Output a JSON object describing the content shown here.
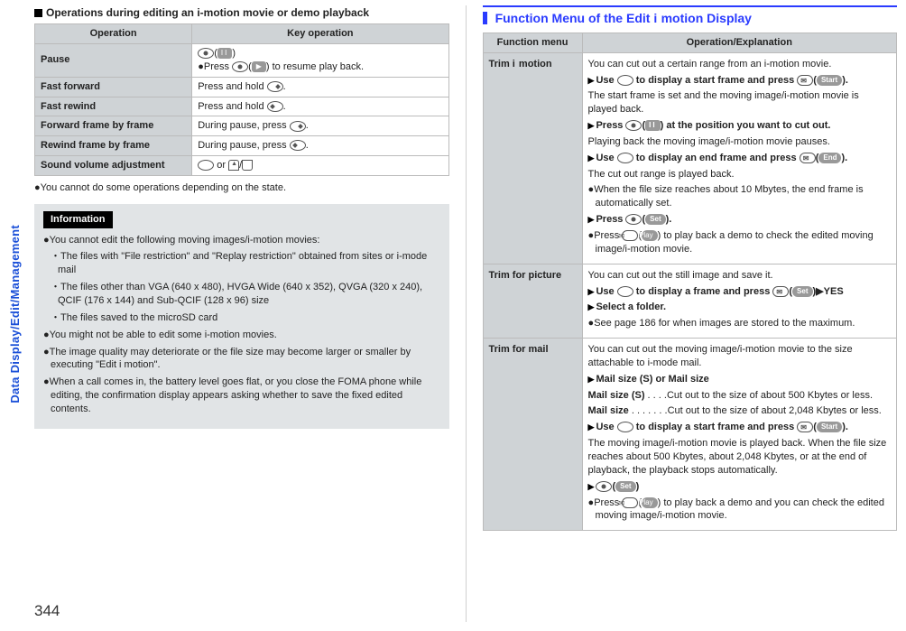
{
  "side_tab": "Data Display/Edit/Management",
  "page_number": "344",
  "left": {
    "heading": "Operations during editing an i-motion movie or demo playback",
    "table": {
      "col_operation": "Operation",
      "col_key": "Key operation",
      "rows": {
        "pause": {
          "op": "Pause",
          "key_l1a": "(",
          "key_l1b": ")",
          "key_l2": "Press ",
          "key_l2b": "(",
          "key_l2c": ") to resume play back."
        },
        "ff": {
          "op": "Fast forward",
          "key": "Press and hold ",
          "key2": "."
        },
        "fr": {
          "op": "Fast rewind",
          "key": "Press and hold ",
          "key2": "."
        },
        "ffr": {
          "op": "Forward frame by frame",
          "key": "During pause, press ",
          "key2": "."
        },
        "rfr": {
          "op": "Rewind frame by frame",
          "key": "During pause, press ",
          "key2": "."
        },
        "vol": {
          "op": "Sound volume adjustment",
          "or": " or ",
          "slash": "/"
        }
      }
    },
    "note_below": "You cannot do some operations depending on the state.",
    "info": {
      "title": "Information",
      "p1": "You cannot edit the following moving images/i-motion movies:",
      "p1a": "The files with \"File restriction\" and \"Replay restriction\" obtained from sites or i-mode mail",
      "p1b": "The files other than VGA (640 x 480), HVGA Wide (640 x 352), QVGA (320 x 240), QCIF (176 x 144) and Sub-QCIF (128 x 96) size",
      "p1c": "The files saved to the microSD card",
      "p2": "You might not be able to edit some i-motion movies.",
      "p3": "The image quality may deteriorate or the file size may become larger or smaller by executing \"Edit  i motion\".",
      "p4": "When a call comes in, the battery level goes flat, or you close the FOMA phone while editing, the confirmation display appears asking whether to save the fixed edited contents."
    }
  },
  "right": {
    "header_a": "Function Menu of the Edit ",
    "header_b": " motion Display",
    "table": {
      "col_menu": "Function menu",
      "col_op": "Operation/Explanation",
      "trim": {
        "menu_a": "Trim ",
        "menu_b": "motion",
        "p1": "You can cut out a certain range from an i-motion movie.",
        "s1a": "Use ",
        "s1b": " to display a start frame and press ",
        "s1c": "(",
        "s1d": ").",
        "p2": "The start frame is set and the moving image/i-motion movie is played back.",
        "s2a": "Press ",
        "s2b": "(",
        "s2c": ") at the position you want to cut out.",
        "p3": "Playing back the moving image/i-motion movie pauses.",
        "s3a": "Use ",
        "s3b": " to display an end frame and press ",
        "s3c": "(",
        "s3d": ").",
        "p4": "The cut out range is played back.",
        "b1": "When the file size reaches about 10 Mbytes, the end frame is automatically set.",
        "s4a": "Press ",
        "s4b": "(",
        "s4c": ").",
        "b2a": "Press ",
        "b2b": "(",
        "b2c": ") to play back a demo to check the edited moving image/i-motion movie.",
        "lbl_start": "Start",
        "lbl_end": "End",
        "lbl_set": "Set",
        "lbl_play": "Play"
      },
      "trim_pic": {
        "menu": "Trim for picture",
        "p1": "You can cut out the still image and save it.",
        "s1a": "Use ",
        "s1b": " to display a frame and press ",
        "s1c": "(",
        "s1d": ")",
        "s1e": "YES",
        "s2": "Select a folder.",
        "b1": "See page 186 for when images are stored to the maximum.",
        "lbl_set": "Set"
      },
      "trim_mail": {
        "menu": "Trim for mail",
        "p1": "You can cut out the moving image/i-motion movie to the size attachable to i-mode mail.",
        "s1": "Mail size (S) or Mail size",
        "m1a": "Mail size (S)",
        "m1b": " . . . .Cut out to the size of about 500 Kbytes or less.",
        "m2a": "Mail size",
        "m2b": " . . . . . . .Cut out to the size of about 2,048 Kbytes or less.",
        "s2a": "Use ",
        "s2b": " to display a start frame and press ",
        "s2c": "(",
        "s2d": ").",
        "p2": "The moving image/i-motion movie is played back. When the file size reaches about 500 Kbytes, about 2,048 Kbytes, or at the end of playback, the playback stops automatically.",
        "s3a": "(",
        "s3b": ")",
        "b1a": "Press ",
        "b1b": "(",
        "b1c": ") to play back a demo and you can check the edited moving image/i-motion movie.",
        "lbl_start": "Start",
        "lbl_set": "Set",
        "lbl_play": "Play"
      }
    }
  }
}
